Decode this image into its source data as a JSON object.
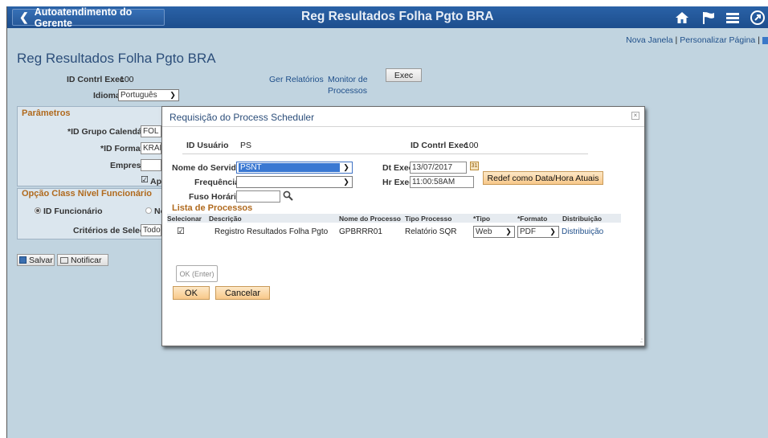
{
  "header": {
    "back_label": "Autoatendimento do Gerente",
    "title": "Reg Resultados Folha Pgto BRA",
    "icons": [
      "home-icon",
      "flag-icon",
      "menu-icon",
      "navbar-icon"
    ]
  },
  "toplinks": {
    "new_window": "Nova Janela",
    "personalize": "Personalizar Página"
  },
  "page": {
    "title": "Reg Resultados Folha Pgto BRA",
    "run_control_label": "ID Contrl Exec",
    "run_control_value": "100",
    "language_label": "Idioma",
    "language_value": "Português",
    "report_manager": "Ger Relatórios",
    "process_monitor_1": "Monitor de",
    "process_monitor_2": "Processos",
    "exec_button": "Exec",
    "params_heading": "Parâmetros",
    "calendar_group_label": "*ID Grupo Calendários",
    "calendar_group_value": "FOL C",
    "format_id_label": "*ID Formato",
    "format_id_value": "KRAL",
    "company_label": "Empresa",
    "company_value": "",
    "checkbox_ap": "Ap",
    "option_heading": "Opção Class Nível Funcionário",
    "radio_employee": "ID Funcionário",
    "radio_no": "No",
    "selection_criteria_label": "Critérios de Seleção",
    "selection_criteria_value": "Todo",
    "save_button": "Salvar",
    "notify_button": "Notificar"
  },
  "modal": {
    "title": "Requisição do Process Scheduler",
    "user_id_label": "ID Usuário",
    "user_id_value": "PS",
    "run_control_label": "ID Contrl Exec",
    "run_control_value": "100",
    "server_label": "Nome do Servidor",
    "server_value": "PSNT",
    "recurrence_label": "Frequência",
    "recurrence_value": "",
    "timezone_label": "Fuso Horário",
    "timezone_value": "",
    "run_date_label": "Dt Exec",
    "run_date_value": "13/07/2017",
    "run_time_label": "Hr Exec",
    "run_time_value": "11:00:58AM",
    "reset_button": "Redef como Data/Hora Atuais",
    "process_list_heading": "Lista de Processos",
    "columns": {
      "select": "Selecionar",
      "description": "Descrição",
      "process_name": "Nome do Processo",
      "process_type": "Tipo Processo",
      "type": "*Tipo",
      "format": "*Formato",
      "distribution": "Distribuição"
    },
    "rows": [
      {
        "selected": true,
        "description": "Registro Resultados Folha Pgto",
        "process_name": "GPBRRR01",
        "process_type": "Relatório SQR",
        "type": "Web",
        "format": "PDF",
        "distribution": "Distribuição"
      }
    ],
    "ok_enter_button": "OK (Enter)",
    "ok_button": "OK",
    "cancel_button": "Cancelar"
  }
}
